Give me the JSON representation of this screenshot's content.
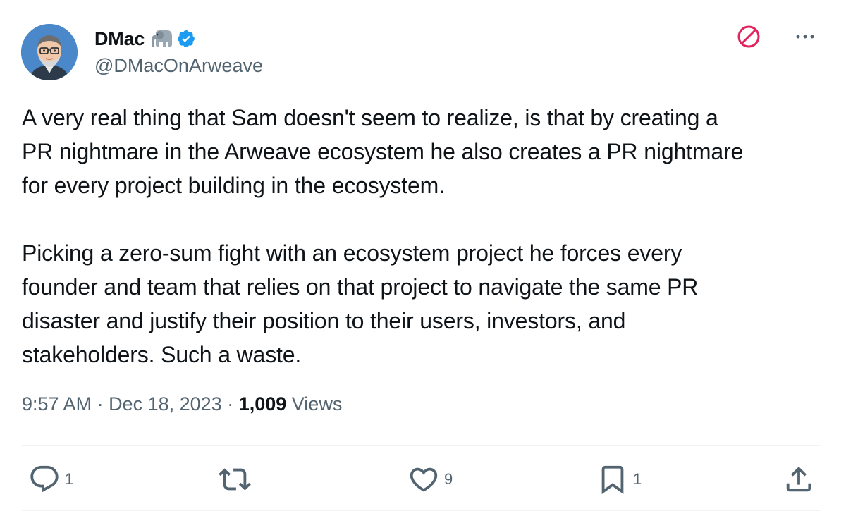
{
  "author": {
    "display_name": "DMac",
    "handle": "@DMacOnArweave",
    "emoji_icon": "elephant-icon",
    "verified_icon": "verified-badge-icon",
    "avatar_icon": "avatar-portrait"
  },
  "header_actions": {
    "blocked_icon": "blocked-icon",
    "more_icon": "more-options-icon",
    "accent": "#e0245e"
  },
  "tweet": {
    "text": "A very real thing that Sam doesn't seem to realize, is that by creating a\nPR nightmare in the Arweave ecosystem he also creates a PR nightmare\nfor every project building in the ecosystem.\n\nPicking a zero-sum fight with an ecosystem project he forces every\nfounder and team that relies on that project to navigate the same PR\ndisaster and justify their position to their users, investors, and\nstakeholders. Such a waste."
  },
  "meta": {
    "time": "9:57 AM",
    "separator": " · ",
    "date": "Dec 18, 2023",
    "views_count": "1,009",
    "views_label": "Views"
  },
  "actions": {
    "reply": {
      "icon": "reply-icon",
      "count": "1"
    },
    "retweet": {
      "icon": "retweet-icon",
      "count": ""
    },
    "like": {
      "icon": "heart-icon",
      "count": "9"
    },
    "bookmark": {
      "icon": "bookmark-icon",
      "count": "1"
    },
    "share": {
      "icon": "share-icon"
    }
  },
  "colors": {
    "text_primary": "#0f1419",
    "text_secondary": "#536471",
    "verified": "#1d9bf0",
    "blocked": "#e0245e",
    "divider": "#eff3f4"
  }
}
